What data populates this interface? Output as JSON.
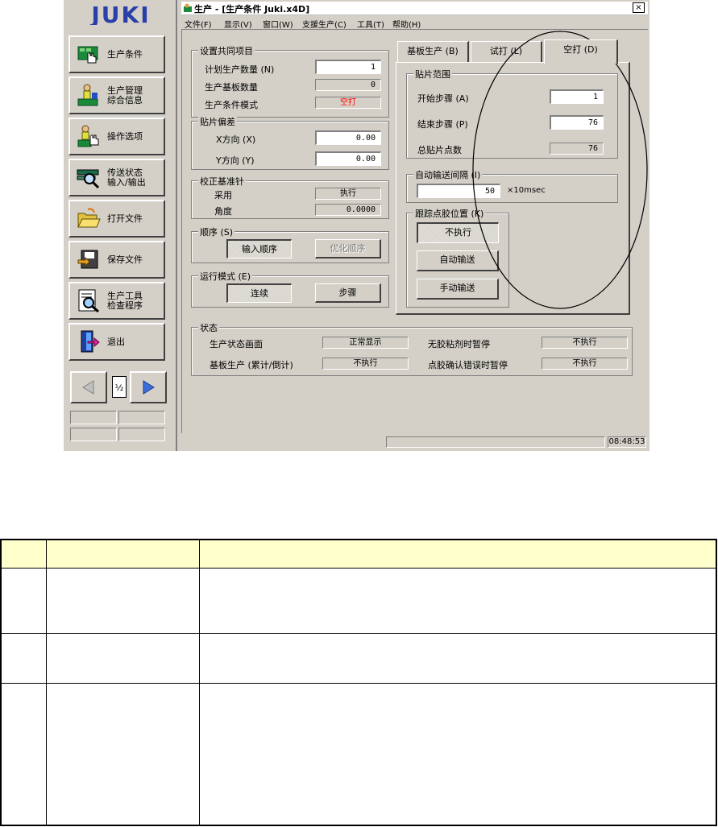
{
  "left_panel": {
    "logo": "JUKI",
    "buttons": [
      {
        "label": "生产条件",
        "icon": "hand-on-board-icon"
      },
      {
        "label": "生产管理\n综合信息",
        "icon": "operator-info-icon"
      },
      {
        "label": "操作选项",
        "icon": "operator-hand-icon"
      },
      {
        "label": "传送状态\n输入/输出",
        "icon": "conveyor-magnifier-icon"
      },
      {
        "label": "打开文件",
        "icon": "open-folder-icon"
      },
      {
        "label": "保存文件",
        "icon": "save-file-icon"
      },
      {
        "label": "生产工具\n检查程序",
        "icon": "tool-check-icon"
      },
      {
        "label": "退出",
        "icon": "exit-door-icon"
      }
    ],
    "page_indicator": "½"
  },
  "window": {
    "title": "生产 - [生产条件 Juki.x4D]",
    "close": "×",
    "menu": [
      "文件(F)",
      "显示(V)",
      "窗口(W)",
      "支援生产(C)",
      "工具(T)",
      "帮助(H)"
    ],
    "status_time": "08:48:53"
  },
  "common": {
    "title": "设置共同项目",
    "planned_label": "计划生产数量 (N)",
    "planned_value": "1",
    "boards_label": "生产基板数量",
    "boards_value": "0",
    "mode_label": "生产条件模式",
    "mode_value": "空打"
  },
  "offset": {
    "title": "贴片偏差",
    "x_label": "X方向 (X)",
    "x_value": "0.00",
    "y_label": "Y方向 (Y)",
    "y_value": "0.00"
  },
  "fiducial": {
    "title": "校正基准针",
    "use_label": "采用",
    "use_value": "执行",
    "angle_label": "角度",
    "angle_value": "0.0000"
  },
  "order": {
    "title": "顺序 (S)",
    "input_btn": "输入顺序",
    "opt_btn": "优化顺序"
  },
  "run_mode": {
    "title": "运行模式 (E)",
    "cont_btn": "连续",
    "step_btn": "步骤"
  },
  "tabs": [
    "基板生产 (B)",
    "试打 (L)",
    "空打 (D)"
  ],
  "mount_range": {
    "title": "贴片范围",
    "start_label": "开始步骤 (A)",
    "start_value": "1",
    "end_label": "结束步骤 (P)",
    "end_value": "76",
    "total_label": "总贴片点数",
    "total_value": "76"
  },
  "auto_interval": {
    "title": "自动输送间隔 (I)",
    "value": "50",
    "unit": "×10msec"
  },
  "track": {
    "title": "跟踪点胶位置 (K)",
    "btn1": "不执行",
    "btn2": "自动输送",
    "btn3": "手动输送"
  },
  "status": {
    "title": "状态",
    "rows": [
      {
        "l1": "生产状态画面",
        "v1": "正常显示",
        "l2": "无胶粘剂时暂停",
        "v2": "不执行"
      },
      {
        "l1": "基板生产 (累计/倒计)",
        "v1": "不执行",
        "l2": "点胶确认错误时暂停",
        "v2": "不执行"
      }
    ]
  },
  "colors": {
    "accent_red": "#ff0000",
    "window_bg": "#d4d0c8",
    "table_header": "#ffffcc"
  }
}
